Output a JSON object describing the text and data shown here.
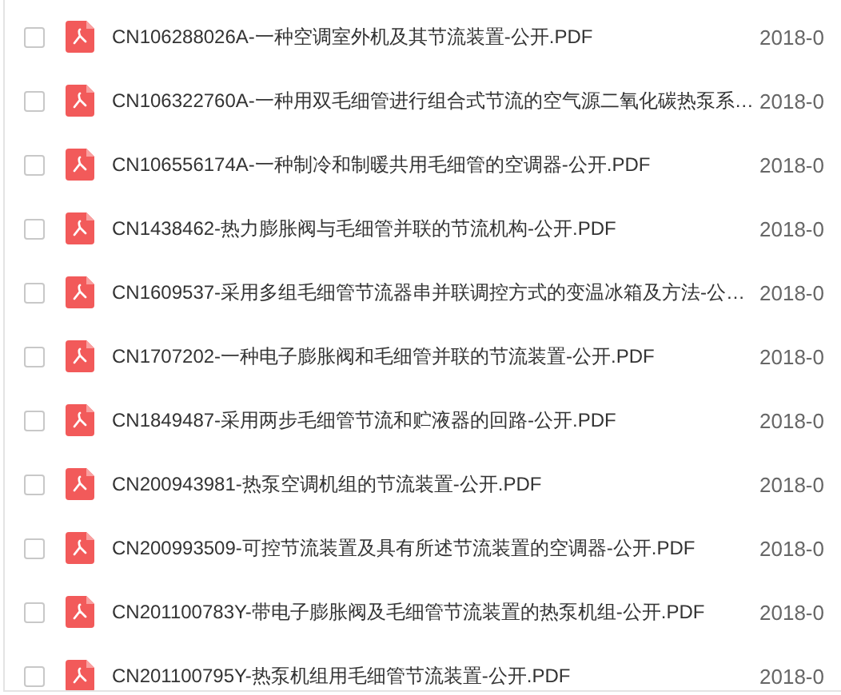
{
  "files": [
    {
      "name": "CN106288026A-一种空调室外机及其节流装置-公开.PDF",
      "date": "2018-0",
      "checked": false
    },
    {
      "name": "CN106322760A-一种用双毛细管进行组合式节流的空气源二氧化碳热泵系…",
      "date": "2018-0",
      "checked": false
    },
    {
      "name": "CN106556174A-一种制冷和制暖共用毛细管的空调器-公开.PDF",
      "date": "2018-0",
      "checked": false
    },
    {
      "name": "CN1438462-热力膨胀阀与毛细管并联的节流机构-公开.PDF",
      "date": "2018-0",
      "checked": false
    },
    {
      "name": "CN1609537-采用多组毛细管节流器串并联调控方式的变温冰箱及方法-公…",
      "date": "2018-0",
      "checked": false
    },
    {
      "name": "CN1707202-一种电子膨胀阀和毛细管并联的节流装置-公开.PDF",
      "date": "2018-0",
      "checked": false
    },
    {
      "name": "CN1849487-采用两步毛细管节流和贮液器的回路-公开.PDF",
      "date": "2018-0",
      "checked": false
    },
    {
      "name": "CN200943981-热泵空调机组的节流装置-公开.PDF",
      "date": "2018-0",
      "checked": false
    },
    {
      "name": "CN200993509-可控节流装置及具有所述节流装置的空调器-公开.PDF",
      "date": "2018-0",
      "checked": false
    },
    {
      "name": "CN201100783Y-带电子膨胀阀及毛细管节流装置的热泵机组-公开.PDF",
      "date": "2018-0",
      "checked": false
    },
    {
      "name": "CN201100795Y-热泵机组用毛细管节流装置-公开.PDF",
      "date": "2018-0",
      "checked": false
    }
  ]
}
